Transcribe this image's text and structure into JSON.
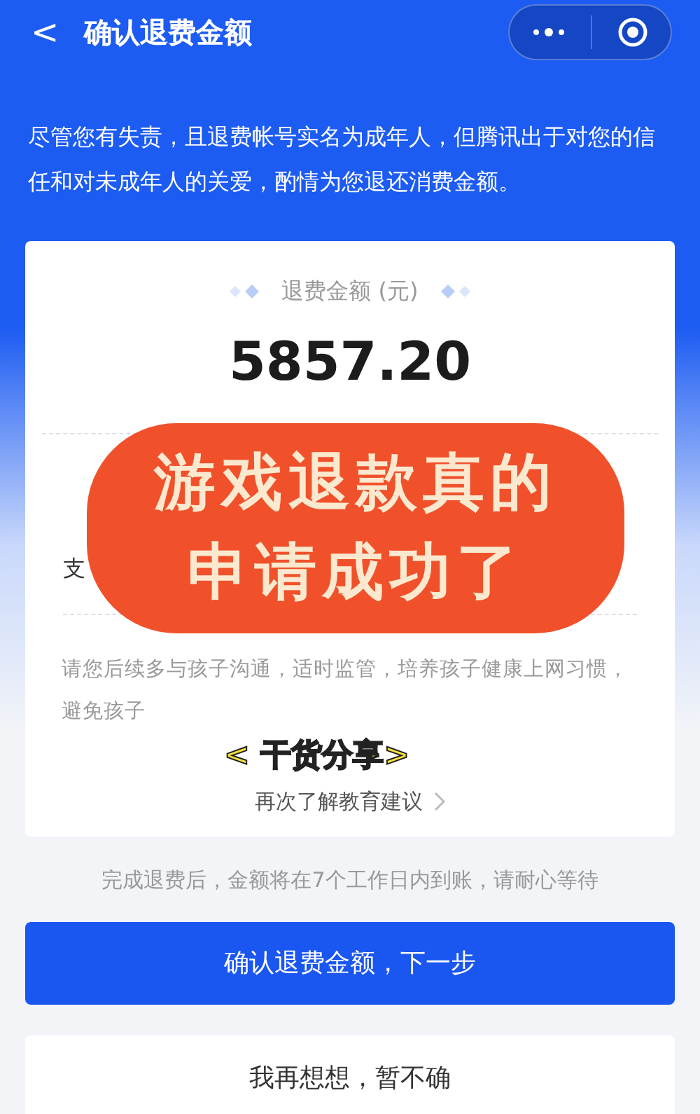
{
  "title_bar": {
    "back": "<",
    "title": "确认退费金额"
  },
  "notice": "尽管您有失责，且退费帐号实名为成年人，但腾讯出于对您的信任和对未成年人的关爱，酌情为您退还消费金额。",
  "card": {
    "amount_label": "退费金额 (元)",
    "amount": "5857.20",
    "row_label": "支",
    "advice": "请您后续多与孩子沟通，适时监管，培养孩子健康上网习惯，避免孩子",
    "link": "再次了解教育建议"
  },
  "sticker": {
    "lines": [
      "游戏退款真的",
      "申请成功了"
    ],
    "tag": "< 干货分享>"
  },
  "footer_note": "完成退费后，金额将在7个工作日内到账，请耐心等待",
  "buttons": [
    {
      "kind": "primary",
      "label": "确认退费金额，下一步"
    },
    {
      "kind": "secondary",
      "label": "我再想想，暂不确"
    }
  ]
}
